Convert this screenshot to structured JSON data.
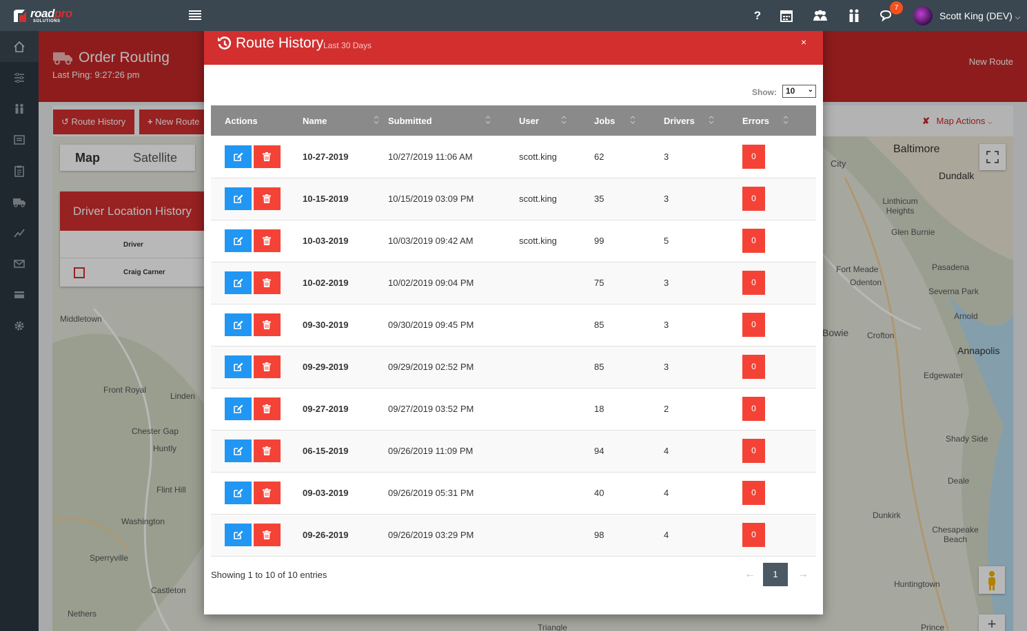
{
  "brand": {
    "word_a": "road",
    "word_b": "pro",
    "sub": "SOLUTIONS"
  },
  "topnav": {
    "notification_count": "7",
    "user_name": "Scott King (DEV)",
    "help_glyph": "?"
  },
  "page": {
    "title": "Order Routing",
    "last_ping": "Last Ping: 9:27:26 pm",
    "new_route_link": "New Route",
    "route_history_button": "Route History",
    "new_route_button": "New Route",
    "map_actions": "Map Actions",
    "map_tab": "Map",
    "satellite_tab": "Satellite"
  },
  "driver_panel": {
    "title": "Driver Location History",
    "column": "Driver",
    "driver_name": "Craig Carner"
  },
  "map_labels": [
    "Baltimore",
    "Dundalk",
    "Linthicum Heights",
    "Glen Burnie",
    "Pasadena",
    "Fort Meade",
    "Odenton",
    "Severna Park",
    "Arnold",
    "Bowie",
    "Crofton",
    "Annapolis",
    "Edgewater",
    "Shady Side",
    "Deale",
    "Dunkirk",
    "Chesapeake Beach",
    "Huntingtown",
    "Middletown",
    "Front Royal",
    "Linden",
    "Chester Gap",
    "Huntly",
    "Flint Hill",
    "Washington",
    "Sperryville",
    "Castleton",
    "Nethers",
    "Triangle",
    "Prince",
    "City"
  ],
  "modal": {
    "title": "Route History",
    "subtitle": "Last 30 Days",
    "close": "×",
    "show_label": "Show:",
    "show_value": "10",
    "columns": [
      "Actions",
      "Name",
      "Submitted",
      "User",
      "Jobs",
      "Drivers",
      "Errors"
    ],
    "rows": [
      {
        "name": "10-27-2019",
        "submitted": "10/27/2019 11:06 AM",
        "user": "scott.king",
        "jobs": "62",
        "drivers": "3",
        "errors": "0"
      },
      {
        "name": "10-15-2019",
        "submitted": "10/15/2019 03:09 PM",
        "user": "scott.king",
        "jobs": "35",
        "drivers": "3",
        "errors": "0"
      },
      {
        "name": "10-03-2019",
        "submitted": "10/03/2019 09:42 AM",
        "user": "scott.king",
        "jobs": "99",
        "drivers": "5",
        "errors": "0"
      },
      {
        "name": "10-02-2019",
        "submitted": "10/02/2019 09:04 PM",
        "user": "",
        "jobs": "75",
        "drivers": "3",
        "errors": "0"
      },
      {
        "name": "09-30-2019",
        "submitted": "09/30/2019 09:45 PM",
        "user": "",
        "jobs": "85",
        "drivers": "3",
        "errors": "0"
      },
      {
        "name": "09-29-2019",
        "submitted": "09/29/2019 02:52 PM",
        "user": "",
        "jobs": "85",
        "drivers": "3",
        "errors": "0"
      },
      {
        "name": "09-27-2019",
        "submitted": "09/27/2019 03:52 PM",
        "user": "",
        "jobs": "18",
        "drivers": "2",
        "errors": "0"
      },
      {
        "name": "06-15-2019",
        "submitted": "09/26/2019 11:09 PM",
        "user": "",
        "jobs": "94",
        "drivers": "4",
        "errors": "0"
      },
      {
        "name": "09-03-2019",
        "submitted": "09/26/2019 05:31 PM",
        "user": "",
        "jobs": "40",
        "drivers": "4",
        "errors": "0"
      },
      {
        "name": "09-26-2019",
        "submitted": "09/26/2019 03:29 PM",
        "user": "",
        "jobs": "98",
        "drivers": "4",
        "errors": "0"
      }
    ],
    "footer_info": "Showing 1 to 10 of 10 entries",
    "pager": {
      "prev": "←",
      "current": "1",
      "next": "→"
    }
  },
  "colors": {
    "topnav": "#3a4750",
    "sidebar": "#2c3840",
    "brand_red": "#d32f2f",
    "edit_blue": "#2196f3",
    "delete_red": "#f44336",
    "table_header": "#8a8a8a",
    "pager_active": "#4a5963"
  },
  "icons": [
    "home-icon",
    "sliders-icon",
    "users-icon",
    "news-icon",
    "clipboard-icon",
    "truck-icon",
    "chart-line-icon",
    "mail-icon",
    "credit-card-icon",
    "gear-icon",
    "help-icon",
    "calendar-icon",
    "group-icon",
    "pair-icon",
    "chat-icon",
    "history-icon",
    "edit-icon",
    "trash-icon",
    "fullscreen-icon",
    "pegman-icon",
    "zoom-in-icon"
  ]
}
